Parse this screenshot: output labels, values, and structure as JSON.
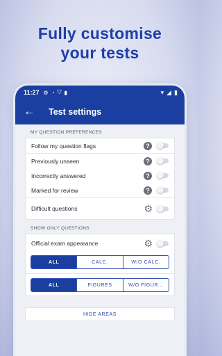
{
  "headline": {
    "line1": "Fully customise",
    "line2": "your tests"
  },
  "status": {
    "time": "11:27",
    "icons": [
      "settings-icon",
      "cast-icon",
      "shield-icon",
      "sdcard-icon"
    ],
    "right_icons": [
      "wifi-icon",
      "signal-icon",
      "battery-icon"
    ]
  },
  "appbar": {
    "back": "←",
    "title": "Test settings"
  },
  "preferences": {
    "label": "MY QUESTION PREFERENCES",
    "flags": "Follow my question flags",
    "unseen": "Previously unseen",
    "incorrect": "Incorrectly answered",
    "review": "Marked for review",
    "difficult": "Difficult questions"
  },
  "show_only": {
    "label": "SHOW ONLY QUESTIONS",
    "official": "Official exam appearance",
    "seg1": [
      "ALL",
      "CALC.",
      "W/O CALC."
    ],
    "seg2": [
      "ALL",
      "FIGURES",
      "W/O FIGUR..."
    ]
  },
  "hide_areas": "HIDE AREAS",
  "glyphs": {
    "help": "?",
    "gear": "⚙"
  },
  "colors": {
    "primary": "#1a3fa0",
    "headline": "#1e3fa8"
  }
}
